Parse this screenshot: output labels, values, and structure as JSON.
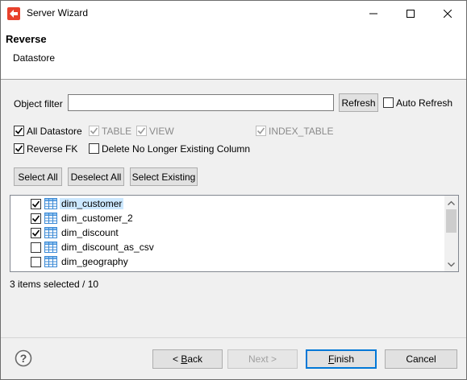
{
  "window": {
    "title": "Server Wizard"
  },
  "header": {
    "title": "Reverse",
    "subtitle": "Datastore"
  },
  "filter": {
    "label": "Object filter",
    "value": "",
    "refresh_label": "Refresh",
    "auto_refresh_label": "Auto Refresh",
    "auto_refresh_checked": false
  },
  "options": {
    "all_datastore": {
      "label": "All Datastore",
      "checked": true
    },
    "table": {
      "label": "TABLE",
      "checked": true,
      "enabled": false
    },
    "view": {
      "label": "VIEW",
      "checked": true,
      "enabled": false
    },
    "index_table": {
      "label": "INDEX_TABLE",
      "checked": true,
      "enabled": false
    },
    "reverse_fk": {
      "label": "Reverse FK",
      "checked": true
    },
    "delete_no_longer": {
      "label": "Delete No Longer Existing Column",
      "checked": false
    }
  },
  "actions": {
    "select_all": "Select All",
    "deselect_all": "Deselect All",
    "select_existing": "Select Existing"
  },
  "objects": [
    {
      "name": "dim_customer",
      "checked": true,
      "selected": true
    },
    {
      "name": "dim_customer_2",
      "checked": true,
      "selected": false
    },
    {
      "name": "dim_discount",
      "checked": true,
      "selected": false
    },
    {
      "name": "dim_discount_as_csv",
      "checked": false,
      "selected": false
    },
    {
      "name": "dim_geography",
      "checked": false,
      "selected": false
    }
  ],
  "status": {
    "selection_text": "3 items selected / 10"
  },
  "footer": {
    "back_prefix": "< ",
    "back_mnemonic": "B",
    "back_rest": "ack",
    "next_label": "Next >",
    "finish_mnemonic": "F",
    "finish_rest": "inish",
    "cancel_label": "Cancel"
  }
}
